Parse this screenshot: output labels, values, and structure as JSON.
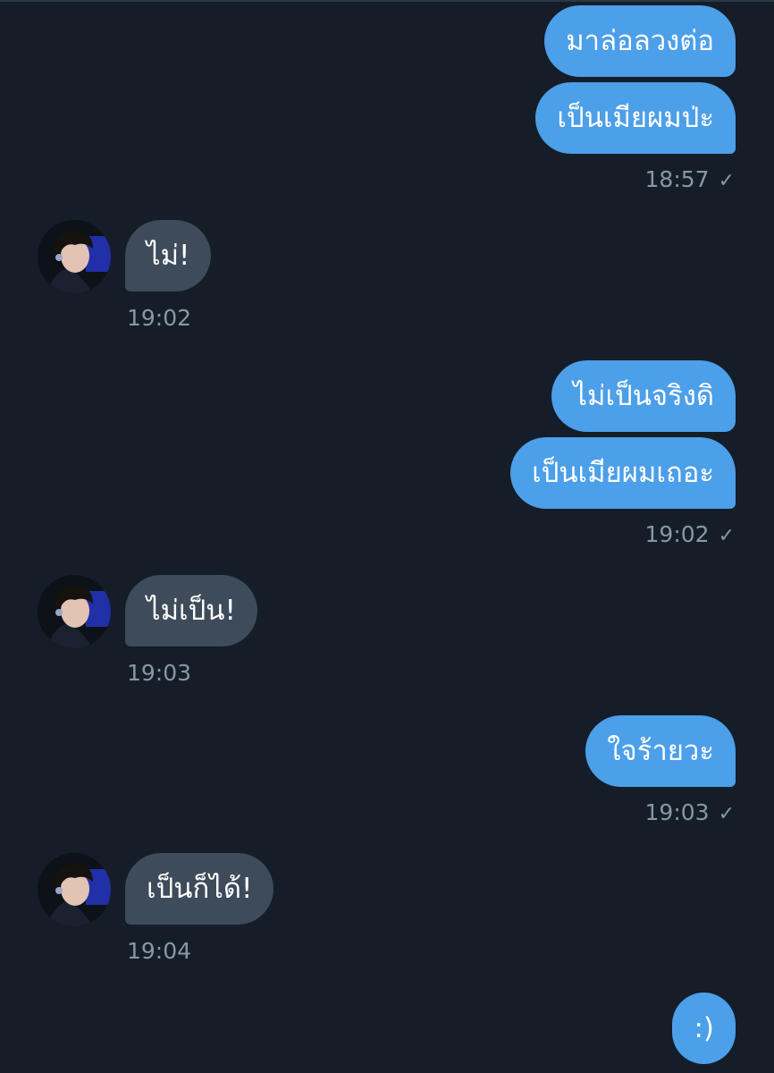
{
  "colors": {
    "background": "#151d28",
    "sent_bubble": "#4c9fe9",
    "received_bubble": "#3d4b5a",
    "timestamp": "#8a96a3"
  },
  "messages": [
    {
      "side": "sent",
      "text": "มาล่อลวงต่อ"
    },
    {
      "side": "sent",
      "text": "เป็นเมียผมป่ะ",
      "time": "18:57",
      "read_icon": "checkmark-icon"
    },
    {
      "side": "received",
      "text": "ไม่!",
      "time": "19:02",
      "avatar": "contact-avatar"
    },
    {
      "side": "sent",
      "text": "ไม่เป็นจริงดิ"
    },
    {
      "side": "sent",
      "text": "เป็นเมียผมเถอะ",
      "time": "19:02",
      "read_icon": "checkmark-icon"
    },
    {
      "side": "received",
      "text": "ไม่เป็น!",
      "time": "19:03",
      "avatar": "contact-avatar"
    },
    {
      "side": "sent",
      "text": "ใจร้ายวะ",
      "time": "19:03",
      "read_icon": "checkmark-icon"
    },
    {
      "side": "received",
      "text": "เป็นก็ได้!",
      "time": "19:04",
      "avatar": "contact-avatar"
    },
    {
      "side": "sent",
      "text": ":)"
    }
  ]
}
